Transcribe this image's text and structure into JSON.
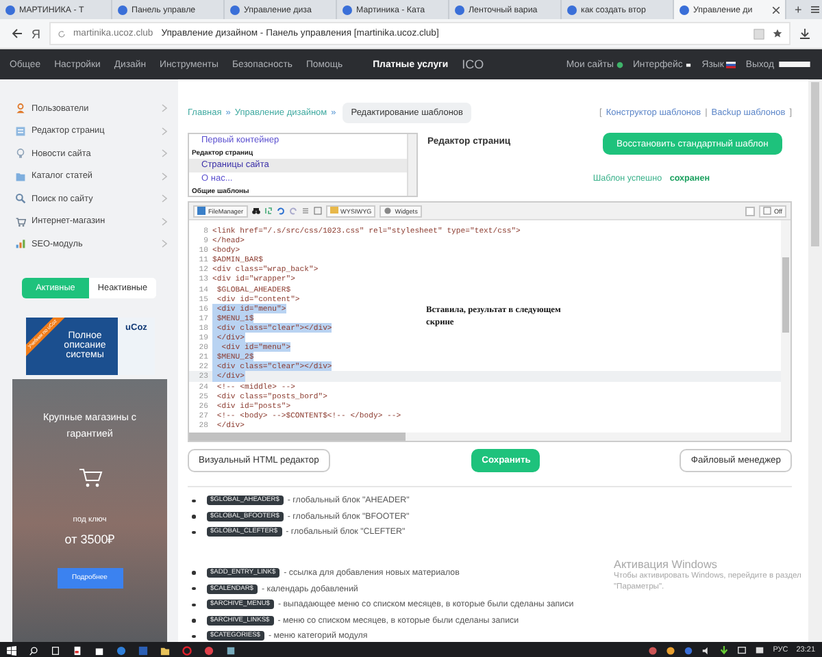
{
  "browser": {
    "tabs": [
      {
        "title": "МАРТИНИКА - Т",
        "selected": false
      },
      {
        "title": "Панель управле",
        "selected": false
      },
      {
        "title": "Управление диза",
        "selected": false
      },
      {
        "title": "Мартиника - Ката",
        "selected": false
      },
      {
        "title": "Ленточный вариа",
        "selected": false
      },
      {
        "title": "как создать втор",
        "selected": false
      },
      {
        "title": "Управление ди",
        "selected": true
      }
    ],
    "new_tab": "+",
    "home_letter": "Я",
    "url_domain": "martinika.ucoz.club",
    "page_title": "Управление дизайном - Панель управления [martinika.ucoz.club]"
  },
  "nav": {
    "items": [
      {
        "label": "Общее",
        "selected": false
      },
      {
        "label": "Настройки",
        "selected": false
      },
      {
        "label": "Дизайн",
        "selected": false
      },
      {
        "label": "Инструменты",
        "selected": false
      },
      {
        "label": "Безопасность",
        "selected": false
      },
      {
        "label": "Помощь",
        "selected": false
      },
      {
        "label": "Платные услуги",
        "selected": true
      },
      {
        "label": "ICO",
        "selected": false
      }
    ],
    "right": [
      {
        "label": "Мои сайты",
        "kind": "globe"
      },
      {
        "label": "Интерфейс",
        "kind": "square"
      },
      {
        "label": "Язык",
        "kind": "flag"
      },
      {
        "label": "Выход",
        "kind": "bar"
      }
    ]
  },
  "sidebar": {
    "items": [
      {
        "label": "Пользователи",
        "kind": "user"
      },
      {
        "label": "Редактор страниц",
        "kind": "page"
      },
      {
        "label": "Новости сайта",
        "kind": "bulb"
      },
      {
        "label": "Каталог статей",
        "kind": "folder"
      },
      {
        "label": "Поиск по сайту",
        "kind": "search"
      },
      {
        "label": "Интернет-магазин",
        "kind": "cart"
      },
      {
        "label": "SEO-модуль",
        "kind": "seo"
      }
    ],
    "toggle": [
      {
        "label": "Активные",
        "selected": true
      },
      {
        "label": "Неактивные",
        "selected": false
      }
    ],
    "banner": {
      "ribbon": "Учебник по uCoz",
      "text": "Полное описание системы",
      "logo": "uCoz"
    },
    "ad": {
      "title": "Крупные магазины с гарантией",
      "subtitle": "под ключ",
      "price": "от 3500₽",
      "button": "Подробнее"
    }
  },
  "breadcrumb": {
    "links": [
      "Главная",
      "Управление дизайном"
    ],
    "separator": "»",
    "current": "Редактирование шаблонов"
  },
  "tool_links": {
    "open": "[",
    "separator": "|",
    "close": "]",
    "links": [
      "Конструктор шаблонов",
      "Backup шаблонов"
    ]
  },
  "template_list": [
    {
      "kind": "item",
      "label": "Первый контейнер",
      "selected": false
    },
    {
      "kind": "header",
      "label": "Редактор страниц"
    },
    {
      "kind": "item",
      "label": "Страницы сайта",
      "selected": true
    },
    {
      "kind": "item",
      "label": "О нас...",
      "selected": false
    },
    {
      "kind": "header",
      "label": "Общие шаблоны"
    }
  ],
  "page_heading": "Редактор страниц",
  "restore_button": "Восстановить стандартный шаблон",
  "status": "Шаблон успешно **сохранен**",
  "editor": {
    "toolbar": {
      "file_manager": "FileManager",
      "wysiwyg": "WYSIWYG",
      "widgets": "Widgets",
      "toggle": "Off",
      "checkbox_checked": false
    },
    "lines": [
      {
        "number": "8",
        "code": "<link href=\"/.s/src/css/1023.css\" rel=\"stylesheet\" type=\"text/css\">",
        "selected": false,
        "current": false
      },
      {
        "number": "9",
        "code": "</head>",
        "selected": false,
        "current": false
      },
      {
        "number": "10",
        "code": "<body>",
        "selected": false,
        "current": false
      },
      {
        "number": "11",
        "code": "$ADMIN_BAR$",
        "selected": false,
        "current": false
      },
      {
        "number": "12",
        "code": "<div class=\"wrap_back\">",
        "selected": false,
        "current": false
      },
      {
        "number": "13",
        "code": "<div id=\"wrapper\">",
        "selected": false,
        "current": false
      },
      {
        "number": "14",
        "code": " $GLOBAL_AHEADER$",
        "selected": false,
        "current": false
      },
      {
        "number": "15",
        "code": " <div id=\"content\">",
        "selected": false,
        "current": false
      },
      {
        "number": "16",
        "code": " <div id=\"menu\">",
        "selected": true,
        "current": false
      },
      {
        "number": "17",
        "code": " $MENU_1$",
        "selected": true,
        "current": false
      },
      {
        "number": "18",
        "code": " <div class=\"clear\"></div>",
        "selected": true,
        "current": false
      },
      {
        "number": "19",
        "code": " </div>",
        "selected": true,
        "current": false
      },
      {
        "number": "20",
        "code": "  <div id=\"menu\">",
        "selected": true,
        "current": false
      },
      {
        "number": "21",
        "code": " $MENU_2$",
        "selected": true,
        "current": false
      },
      {
        "number": "22",
        "code": " <div class=\"clear\"></div>",
        "selected": true,
        "current": false
      },
      {
        "number": "23",
        "code": " </div>",
        "selected": true,
        "current": true
      },
      {
        "number": "24",
        "code": " <!-- <middle> -->",
        "selected": false,
        "current": false
      },
      {
        "number": "25",
        "code": " <div class=\"posts_bord\">",
        "selected": false,
        "current": false
      },
      {
        "number": "26",
        "code": " <div id=\"posts\">",
        "selected": false,
        "current": false
      },
      {
        "number": "27",
        "code": " <!-- <body> -->$CONTENT$<!-- </body> -->",
        "selected": false,
        "current": false
      },
      {
        "number": "28",
        "code": " </div>",
        "selected": false,
        "current": false
      }
    ],
    "note": "Вставила, результат в следующем скрине"
  },
  "buttons": [
    {
      "label": "Визуальный HTML редактор",
      "kind": "plain"
    },
    {
      "label": "Сохранить",
      "kind": "primary"
    },
    {
      "label": "Файловый менеджер",
      "kind": "plain"
    }
  ],
  "variable_groups": [
    [
      {
        "token": "$GLOBAL_AHEADER$",
        "description": "- глобальный блок \"AHEADER\""
      },
      {
        "token": "$GLOBAL_BFOOTER$",
        "description": "- глобальный блок \"BFOOTER\""
      },
      {
        "token": "$GLOBAL_CLEFTER$",
        "description": "- глобальный блок \"CLEFTER\""
      }
    ],
    [
      {
        "token": "$ADD_ENTRY_LINK$",
        "description": "- ссылка для добавления новых материалов"
      },
      {
        "token": "$CALENDAR$",
        "description": "- календарь добавлений"
      },
      {
        "token": "$ARCHIVE_MENU$",
        "description": "- выпадающее меню со списком месяцев, в которые были сделаны записи"
      },
      {
        "token": "$ARCHIVE_LINKS$",
        "description": "- меню со списком месяцев, в которые были сделаны записи"
      },
      {
        "token": "$CATEGORIES$",
        "description": "- меню категорий модуля"
      }
    ]
  ],
  "windows_notice": {
    "title": "Активация Windows",
    "text": "Чтобы активировать Windows, перейдите в раздел \"Параметры\"."
  },
  "taskbar": {
    "language": "РУС",
    "time": "23:21"
  }
}
